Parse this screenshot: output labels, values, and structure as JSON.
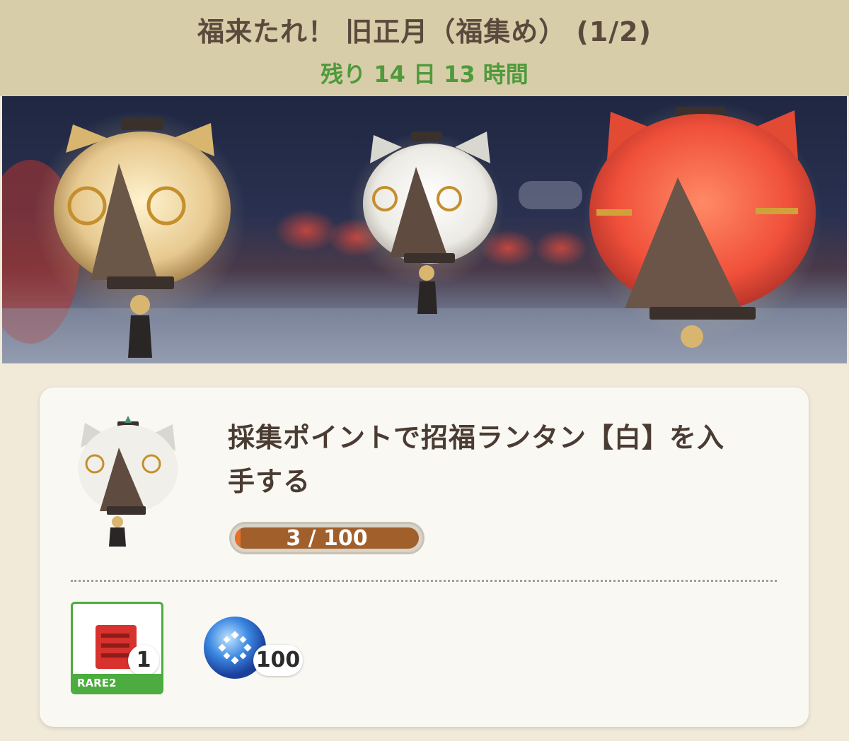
{
  "event": {
    "title": "福来たれ！ 旧正月（福集め） (1/2)",
    "remaining": "残り 14 日 13 時間"
  },
  "banner": {
    "lanterns": [
      "gold-lantern",
      "white-lantern",
      "red-lantern"
    ]
  },
  "mission": {
    "description_line1": "採集ポイントで招福ランタン【白】を入",
    "description_line2": "手する",
    "progress_current": 3,
    "progress_total": 100,
    "progress_fraction": 0.03,
    "progress_text": "3 / 100"
  },
  "rewards": [
    {
      "icon": "ticket-icon",
      "rarity": "RARE2",
      "quantity": "1"
    },
    {
      "icon": "orb-icon",
      "quantity": "100"
    }
  ],
  "colors": {
    "header_bg": "#d8cda9",
    "title": "#5a4a3d",
    "remaining": "#4f9a3c",
    "progress_fill": "#e96e2b",
    "progress_track": "#a15f2c",
    "rarity_green": "#4cac3f"
  }
}
